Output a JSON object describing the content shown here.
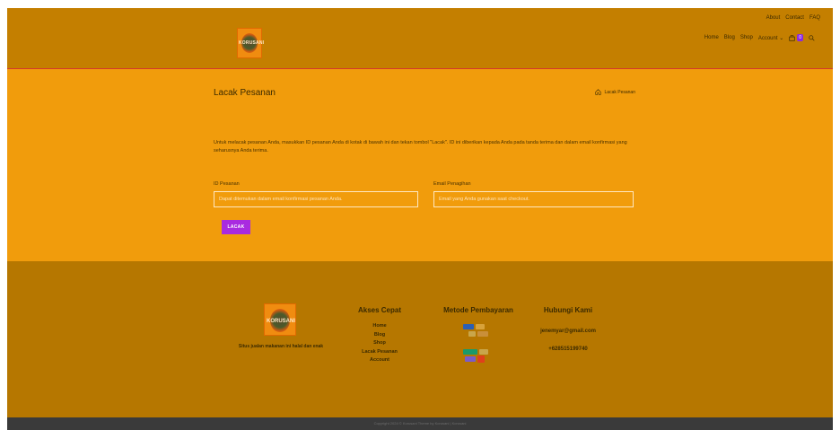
{
  "header": {
    "top_links": [
      "About",
      "Contact",
      "FAQ"
    ],
    "logo_text": "KORUSANI",
    "nav": [
      "Home",
      "Blog",
      "Shop",
      "Account"
    ],
    "cart_count": "0"
  },
  "main": {
    "title": "Lacak Pesanan",
    "breadcrumb": "Lacak Pesanan",
    "intro": "Untuk melacak pesanan Anda, masukkan ID pesanan Anda di kotak di bawah ini dan tekan tombol \"Lacak\". ID ini diberikan kepada Anda pada tanda terima dan dalam email konfirmasi yang seharusnya Anda terima.",
    "order_id_label": "ID Pesanan",
    "order_id_placeholder": "Dapat ditemukan dalam email konfirmasi pesanan Anda.",
    "email_label": "Email Penagihan",
    "email_placeholder": "Email yang Anda gunakan saat checkout.",
    "submit_label": "LACAK"
  },
  "footer": {
    "logo_text": "KORUSANI",
    "tagline": "Situs jualan makanan ini halal dan enak",
    "quick_access_title": "Akses Cepat",
    "quick_links": [
      "Home",
      "Blog",
      "Shop",
      "Lacak Pesanan",
      "Account"
    ],
    "payment_title": "Metode Pembayaran",
    "contact_title": "Hubungi Kami",
    "email": "jenemyar@gmail.com",
    "phone": "+628515199740",
    "copyright": "Copyright 2024 © Korusani Theme by Korusani | Korusani"
  },
  "colors": {
    "header": "#c47f00",
    "main": "#f19c0c",
    "footer": "#b67700",
    "button": "#a92be0",
    "accent_line": "#d43a2a"
  }
}
